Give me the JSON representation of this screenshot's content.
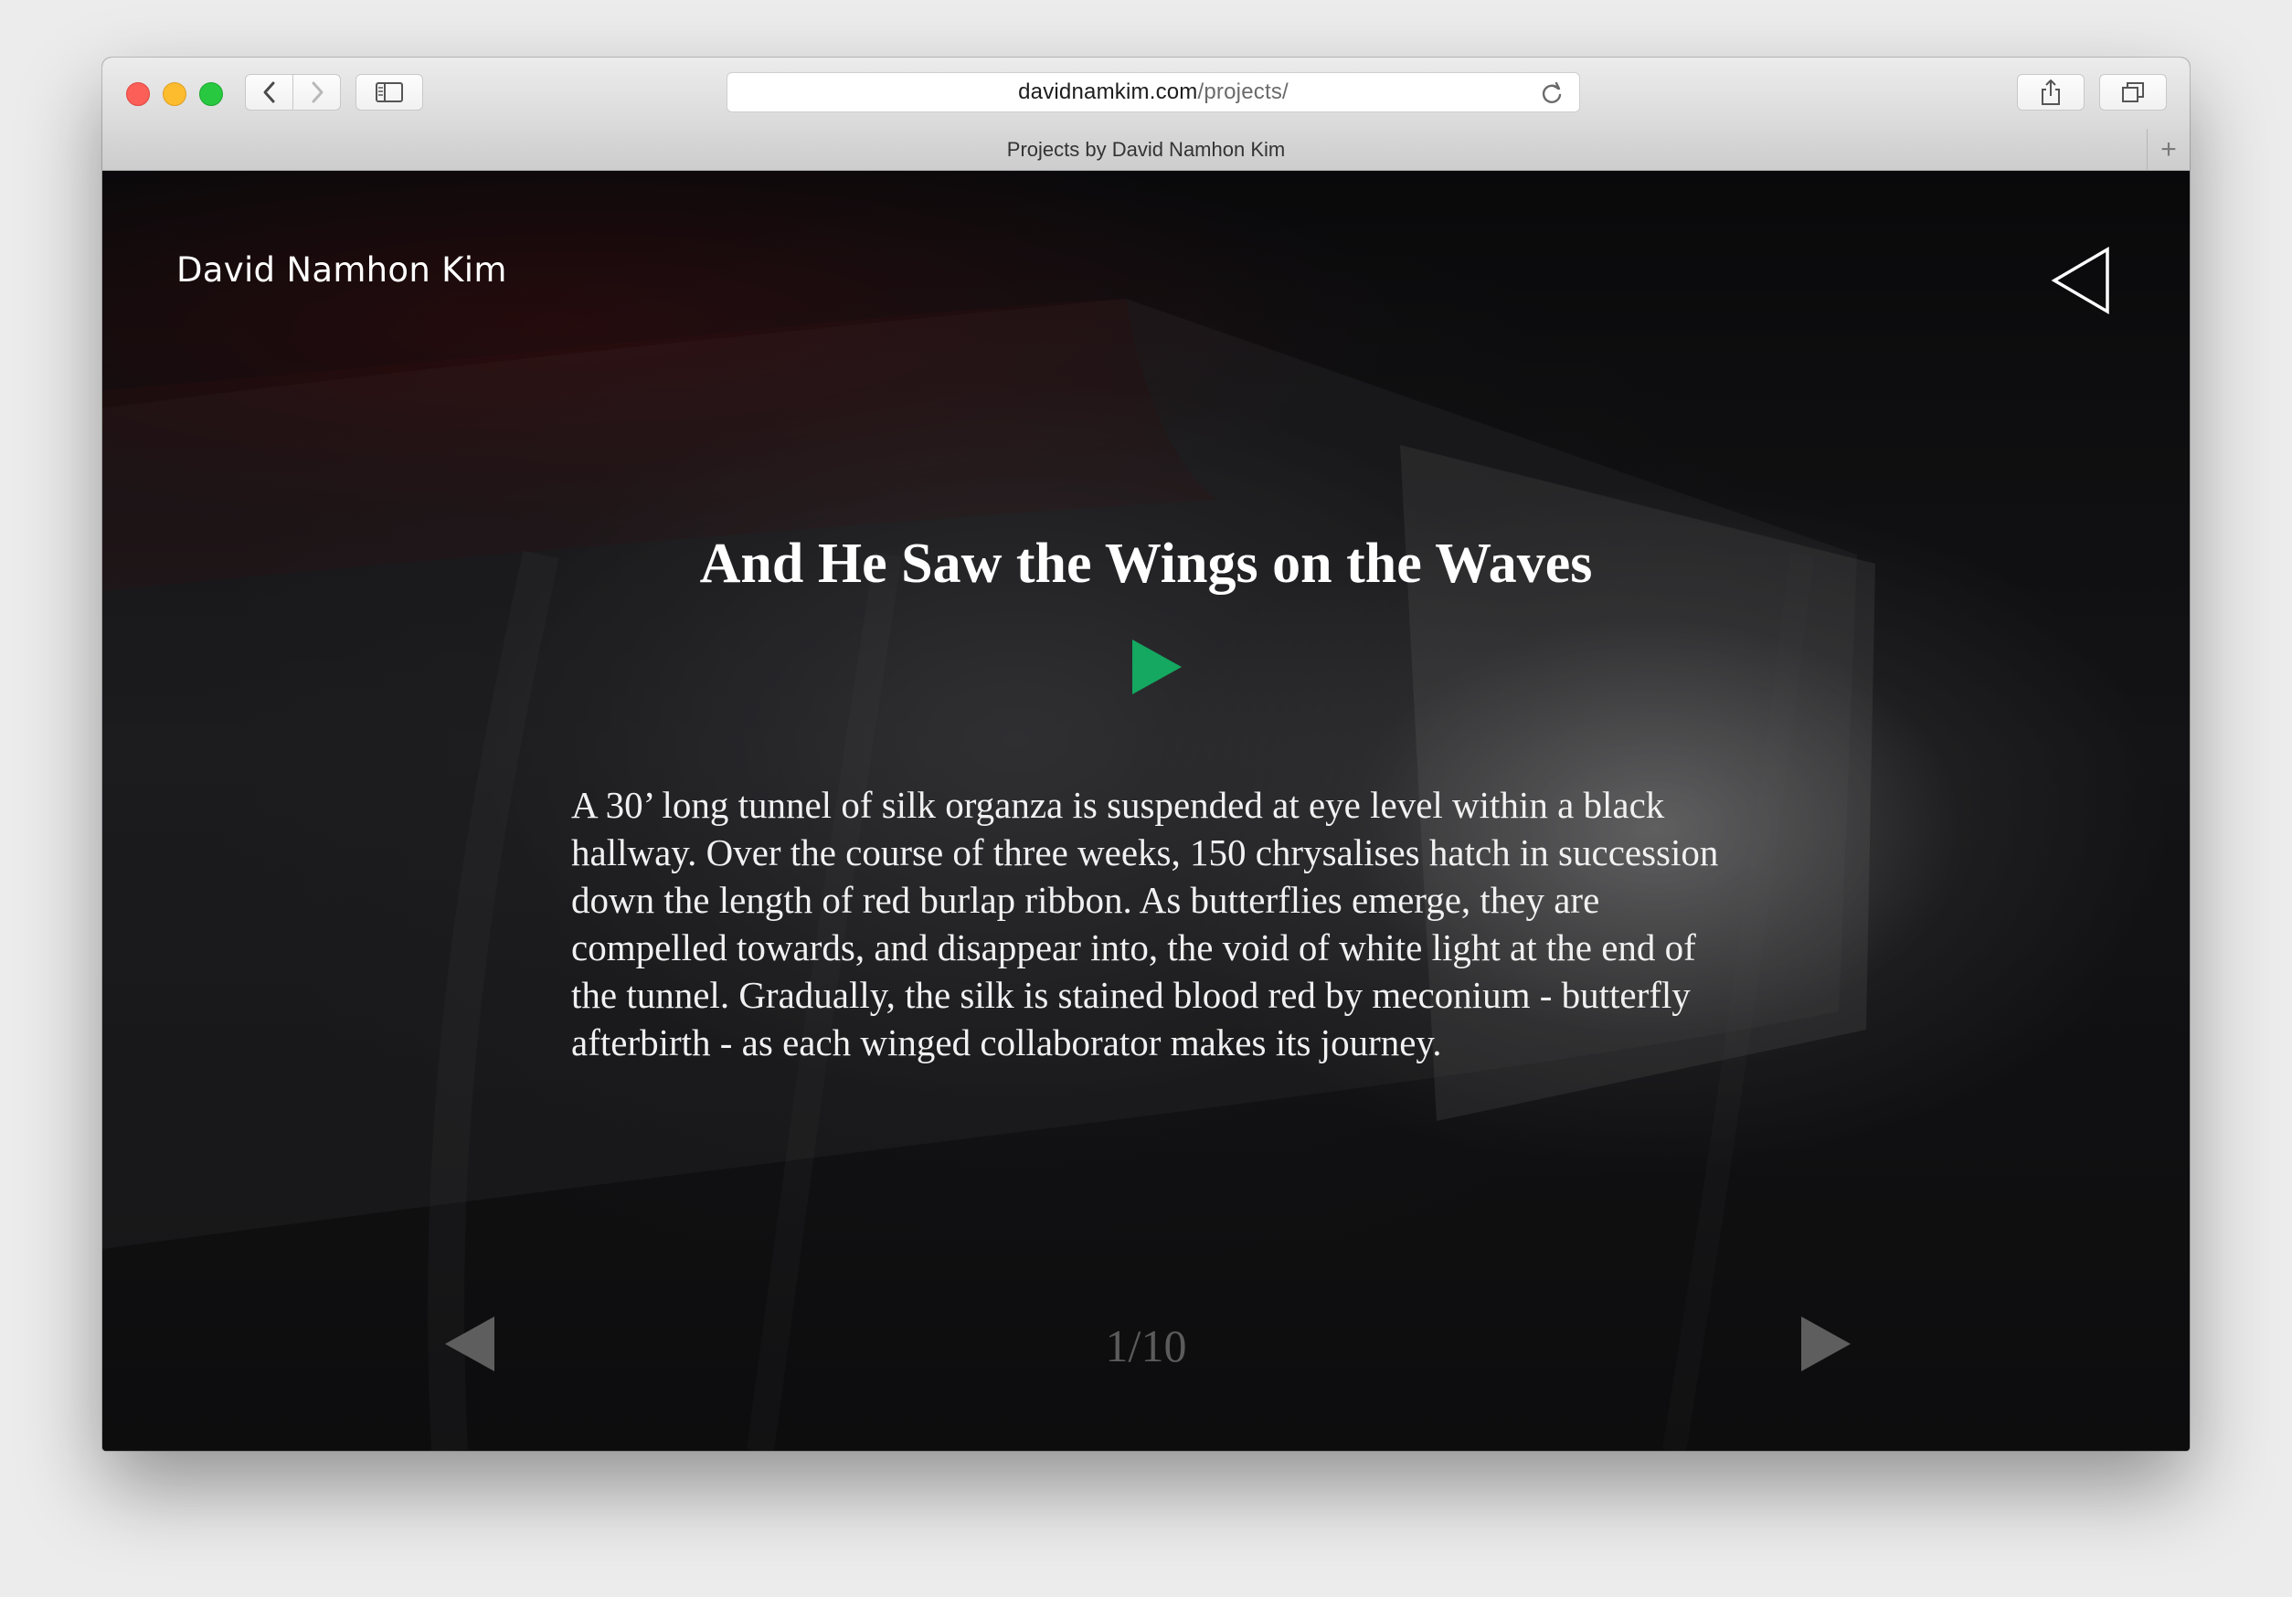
{
  "browser": {
    "url_domain": "davidnamkim.com",
    "url_path": "/projects/",
    "tab_title": "Projects by David Namhon Kim",
    "new_tab_glyph": "+"
  },
  "icons": {
    "back": "chevron-left-icon",
    "forward": "chevron-right-icon",
    "sidebar": "sidebar-icon",
    "reload": "reload-icon",
    "share": "share-icon",
    "tabs": "tabs-overview-icon"
  },
  "site": {
    "name": "David Namhon Kim"
  },
  "project": {
    "title": "And He Saw the Wings on the Waves",
    "description": "A 30’ long tunnel of silk organza is suspended at eye level within a black hallway. Over the course of three weeks, 150 chrysalises hatch in succession down the length of red burlap ribbon. As butterflies emerge, they are compelled towards, and disappear into, the void of white light at the end of the tunnel. Gradually, the silk is stained blood red by meconium - butterfly afterbirth - as each winged collaborator makes its journey.",
    "counter": "1/10",
    "play_color": "#14a860"
  }
}
